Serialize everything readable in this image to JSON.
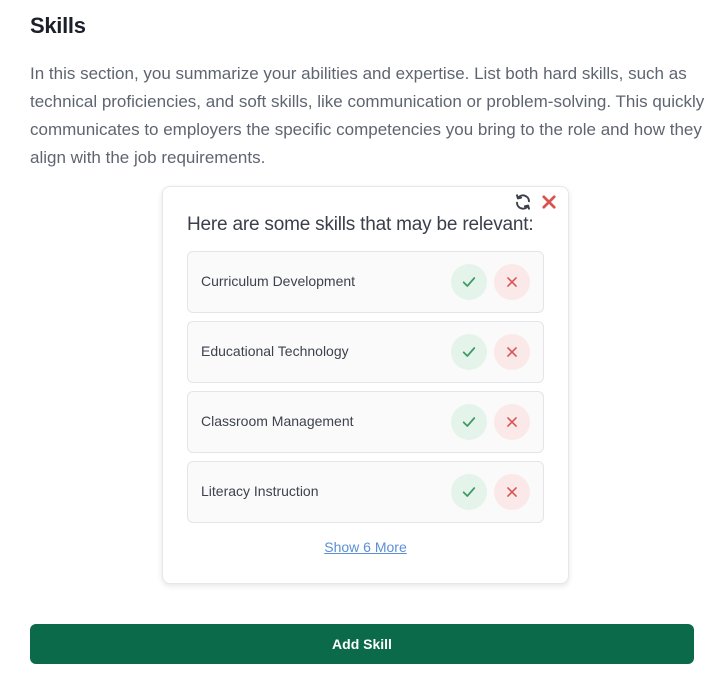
{
  "section": {
    "title": "Skills",
    "description": "In this section, you summarize your abilities and expertise. List both hard skills, such as technical proficiencies, and soft skills, like communication or problem-solving. This quickly communicates to employers the specific competencies you bring to the role and how they align with the job requirements."
  },
  "suggestions": {
    "heading": "Here are some skills that may be relevant:",
    "refresh_icon": "refresh-icon",
    "close_icon": "close-icon",
    "items": [
      {
        "label": "Curriculum Development"
      },
      {
        "label": "Educational Technology"
      },
      {
        "label": "Classroom Management"
      },
      {
        "label": "Literacy Instruction"
      }
    ],
    "show_more_label": "Show 6 More"
  },
  "actions": {
    "add_skill_label": "Add Skill"
  },
  "colors": {
    "accept": "#3f9a66",
    "reject": "#d9534f",
    "primary": "#0b6a4a",
    "link": "#5b8fd6"
  }
}
